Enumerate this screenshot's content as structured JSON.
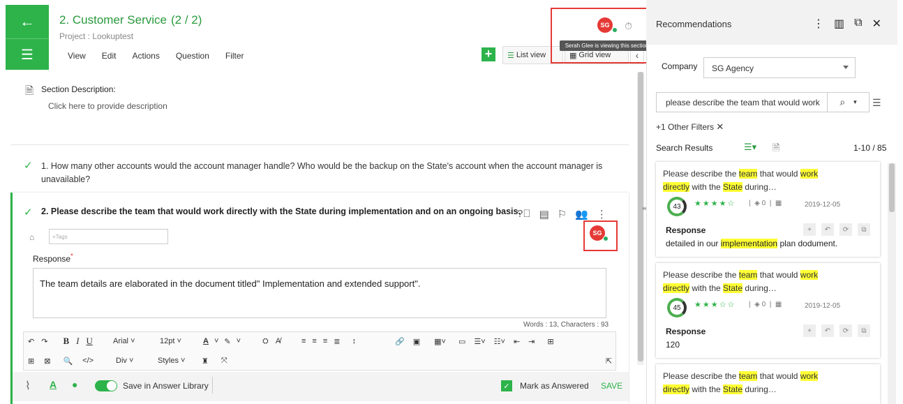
{
  "header": {
    "title": "2. Customer Service",
    "count": "(2 / 2)",
    "project": "Project : Lookuptest",
    "menu": [
      "View",
      "Edit",
      "Actions",
      "Question",
      "Filter"
    ],
    "list_view": "List view",
    "grid_view": "Grid view",
    "avatar_initials": "SG",
    "tooltip": "Serah Glee is viewing this section"
  },
  "section": {
    "label": "Section Description:",
    "placeholder": "Click here to provide description"
  },
  "questions": [
    {
      "text": "1. How many other accounts would the account manager handle? Who would be the backup on the State's account when the account manager is unavailable?"
    },
    {
      "text": "2. Please describe the team that would work directly with the State during implementation and on an ongoing basis."
    }
  ],
  "editor": {
    "tags_placeholder": "+Tags",
    "response_label": "Response",
    "response_text": "The team details are elaborated in the document titled\" Implementation and extended support\".",
    "word_count": "Words : 13, Characters : 93",
    "font": "Arial",
    "size": "12pt",
    "block": "Div",
    "styles": "Styles",
    "save_library": "Save in Answer Library",
    "mark_answered": "Mark as Answered",
    "save": "SAVE"
  },
  "recommendations": {
    "title": "Recommendations",
    "company_label": "Company",
    "company_value": "SG Agency",
    "search_value": "please describe the team that would work",
    "other_filters": "+1 Other Filters",
    "search_results": "Search Results",
    "results_count": "1-10 / 85",
    "cards": [
      {
        "score": "43",
        "stars": "★★★★☆",
        "count": "0",
        "date": "2019-12-05",
        "response_label": "Response",
        "response_pre": "detailed in our ",
        "response_hl": "implementation",
        "response_post": " plan dodument."
      },
      {
        "score": "45",
        "stars": "★★★☆☆",
        "count": "0",
        "date": "2019-12-05",
        "response_label": "Response",
        "response_pre": "120",
        "response_hl": "",
        "response_post": ""
      },
      {
        "score": "",
        "stars": "",
        "count": "",
        "date": "",
        "response_label": "",
        "response_pre": "",
        "response_hl": "",
        "response_post": ""
      }
    ],
    "q_parts": {
      "p1": "Please describe the ",
      "h1": "team",
      "p2": " that would ",
      "h2": "work",
      "h3": "directly",
      "p3": " with the ",
      "h4": "State",
      "p4": " during…"
    }
  }
}
